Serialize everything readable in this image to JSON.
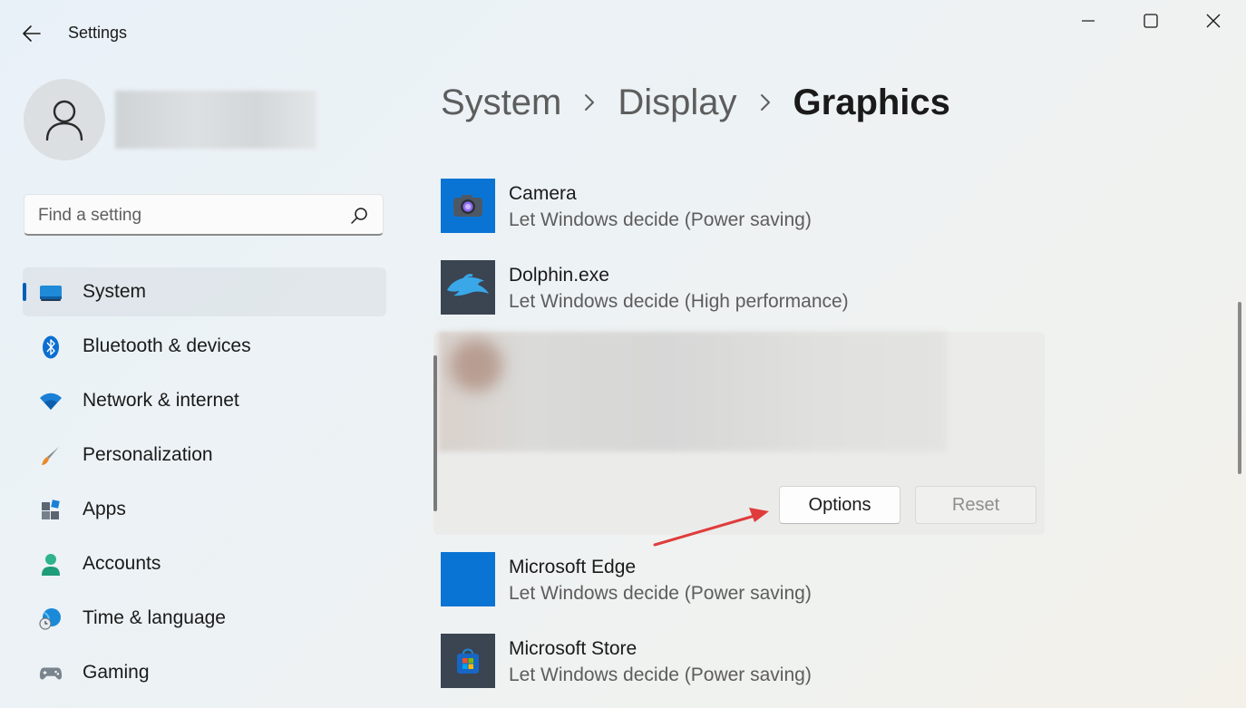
{
  "window": {
    "title": "Settings"
  },
  "search": {
    "placeholder": "Find a setting"
  },
  "nav": {
    "items": [
      {
        "label": "System",
        "icon": "display-icon"
      },
      {
        "label": "Bluetooth & devices",
        "icon": "bluetooth-icon"
      },
      {
        "label": "Network & internet",
        "icon": "wifi-icon"
      },
      {
        "label": "Personalization",
        "icon": "brush-icon"
      },
      {
        "label": "Apps",
        "icon": "apps-icon"
      },
      {
        "label": "Accounts",
        "icon": "person-icon"
      },
      {
        "label": "Time & language",
        "icon": "globe-clock-icon"
      },
      {
        "label": "Gaming",
        "icon": "gamepad-icon"
      }
    ],
    "active_index": 0
  },
  "breadcrumb": {
    "items": [
      "System",
      "Display",
      "Graphics"
    ]
  },
  "apps": [
    {
      "name": "Camera",
      "preference": "Let Windows decide (Power saving)",
      "icon": "camera-icon"
    },
    {
      "name": "Dolphin.exe",
      "preference": "Let Windows decide (High performance)",
      "icon": "dolphin-icon"
    },
    {
      "name": "Microsoft Edge",
      "preference": "Let Windows decide (Power saving)",
      "icon": "edge-icon"
    },
    {
      "name": "Microsoft Store",
      "preference": "Let Windows decide (Power saving)",
      "icon": "store-icon"
    }
  ],
  "expanded_app": {
    "options_label": "Options",
    "reset_label": "Reset"
  },
  "colors": {
    "accent": "#005fb8",
    "annotation_arrow": "#e03c3c",
    "camera_tile": "#0a74d4",
    "edge_tile": "#0a74d4",
    "dolphin_tile": "#3b4451",
    "store_tile": "#3b4451"
  }
}
